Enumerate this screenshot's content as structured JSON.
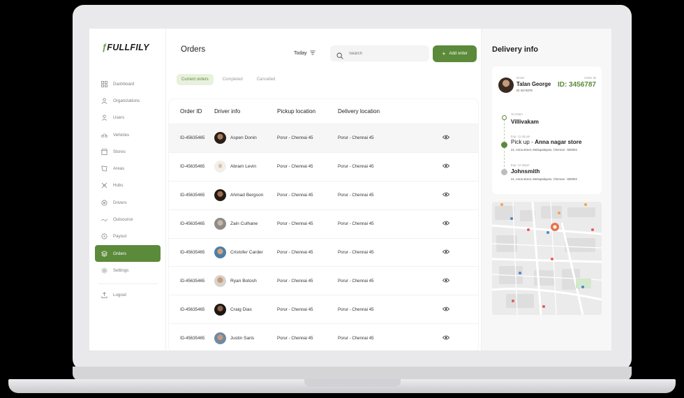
{
  "brand": {
    "logo_text": "FULLFILY",
    "accent": "#5b8a3a"
  },
  "sidebar": {
    "items": [
      {
        "label": "Dashboard",
        "icon": "dashboard-icon"
      },
      {
        "label": "Organizations",
        "icon": "organizations-icon"
      },
      {
        "label": "Users",
        "icon": "user-icon"
      },
      {
        "label": "Vehicles",
        "icon": "vehicle-icon"
      },
      {
        "label": "Stores",
        "icon": "store-icon"
      },
      {
        "label": "Areas",
        "icon": "area-icon"
      },
      {
        "label": "Hubs",
        "icon": "hub-icon"
      },
      {
        "label": "Drivers",
        "icon": "driver-icon"
      },
      {
        "label": "Outsource",
        "icon": "outsource-icon"
      },
      {
        "label": "Payout",
        "icon": "payout-icon"
      },
      {
        "label": "Orders",
        "icon": "orders-icon",
        "active": true
      },
      {
        "label": "Settings",
        "icon": "settings-icon"
      }
    ],
    "logout": {
      "label": "Logout",
      "icon": "logout-icon"
    }
  },
  "header": {
    "title": "Orders",
    "filter_label": "Today",
    "search_placeholder": "Search",
    "add_button": "Add order"
  },
  "tabs": [
    {
      "label": "Current orders",
      "active": true
    },
    {
      "label": "Completed"
    },
    {
      "label": "Cancelled"
    }
  ],
  "table": {
    "columns": [
      "Order ID",
      "Driver info",
      "Pickup location",
      "Delivery location"
    ],
    "rows": [
      {
        "id": "ID-45635465",
        "driver": "Aspen Donin",
        "pickup": "Porur - Chennai 45",
        "delivery": "Porur - Chennai 45"
      },
      {
        "id": "ID-45635465",
        "driver": "Abram Levin",
        "pickup": "Porur - Chennai 45",
        "delivery": "Porur - Chennai 45"
      },
      {
        "id": "ID-45635465",
        "driver": "Ahmad Bergson",
        "pickup": "Porur - Chennai 45",
        "delivery": "Porur - Chennai 45"
      },
      {
        "id": "ID-45635465",
        "driver": "Zain Culhane",
        "pickup": "Porur - Chennai 45",
        "delivery": "Porur - Chennai 45"
      },
      {
        "id": "ID-45635465",
        "driver": "Cristofer Carder",
        "pickup": "Porur - Chennai 45",
        "delivery": "Porur - Chennai 45"
      },
      {
        "id": "ID-45635465",
        "driver": "Ryan Botosh",
        "pickup": "Porur - Chennai 45",
        "delivery": "Porur - Chennai 45"
      },
      {
        "id": "ID-45635465",
        "driver": "Craig Dias",
        "pickup": "Porur - Chennai 45",
        "delivery": "Porur - Chennai 45"
      },
      {
        "id": "ID-45635465",
        "driver": "Justin Saris",
        "pickup": "Porur - Chennai 45",
        "delivery": "Porur - Chennai 45"
      }
    ]
  },
  "delivery_info": {
    "title": "Delivery info",
    "driver_label": "Driver",
    "driver_name": "Talan George",
    "driver_id": "ID 3474878",
    "order_label": "Order ID",
    "order_id": "ID: 3456787",
    "timeline": [
      {
        "time": "10.23am",
        "place": "Villivakam",
        "address": ""
      },
      {
        "time": "Exp. 11.45 pm",
        "prefix": "Pick up - ",
        "place": "Anna nagar store",
        "address": "21, Anna street, Mettupalayam, Chennai - 600002"
      },
      {
        "time": "Exp. 12.25pm",
        "place": "Johnsmith",
        "address": "21, Anna street, Mettupalayam, Chennai - 600002"
      }
    ]
  }
}
